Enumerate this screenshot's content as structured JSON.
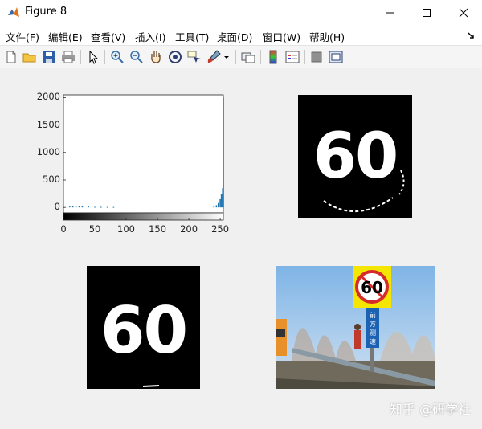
{
  "window": {
    "title": "Figure 8",
    "minimize_glyph": "—",
    "maximize_glyph": "☐",
    "close_glyph": "✕"
  },
  "menu": [
    {
      "label": "文件(F)"
    },
    {
      "label": "编辑(E)"
    },
    {
      "label": "查看(V)"
    },
    {
      "label": "插入(I)"
    },
    {
      "label": "工具(T)"
    },
    {
      "label": "桌面(D)"
    },
    {
      "label": "窗口(W)"
    },
    {
      "label": "帮助(H)"
    }
  ],
  "toolbar": {
    "icons": [
      "new-figure-icon",
      "open-file-icon",
      "save-icon",
      "print-icon",
      "select-arrow-icon",
      "zoom-in-icon",
      "zoom-out-icon",
      "pan-hand-icon",
      "rotate-3d-icon",
      "data-cursor-icon",
      "brush-icon",
      "brush-dropdown-icon",
      "link-plot-icon",
      "colorbar-icon",
      "legend-icon",
      "hide-plot-tools-icon",
      "show-plot-tools-icon"
    ]
  },
  "histogram": {
    "chart_data": {
      "type": "bar",
      "title": "",
      "xlabel": "",
      "ylabel": "",
      "xlim": [
        0,
        255
      ],
      "ylim": [
        -100,
        2050
      ],
      "xticks": [
        "0",
        "50",
        "100",
        "150",
        "200",
        "250"
      ],
      "yticks": [
        "2000",
        "1500",
        "1000",
        "500",
        "0"
      ],
      "series": [
        {
          "x": [
            10,
            15,
            20,
            25,
            30,
            40,
            50,
            60,
            70,
            80,
            240,
            244,
            247,
            250,
            252,
            254,
            255
          ],
          "values": [
            15,
            25,
            30,
            20,
            25,
            15,
            10,
            10,
            8,
            8,
            20,
            40,
            80,
            150,
            250,
            350,
            2000
          ]
        }
      ],
      "colors": {
        "bars": "#1f77b4"
      }
    }
  },
  "images": {
    "binary_top_right": {
      "text": "60"
    },
    "binary_bottom_left": {
      "text": "60"
    },
    "photo": {
      "sign_number": "60",
      "sign_text": "前方测速"
    }
  },
  "watermark": "知乎 @研学社"
}
